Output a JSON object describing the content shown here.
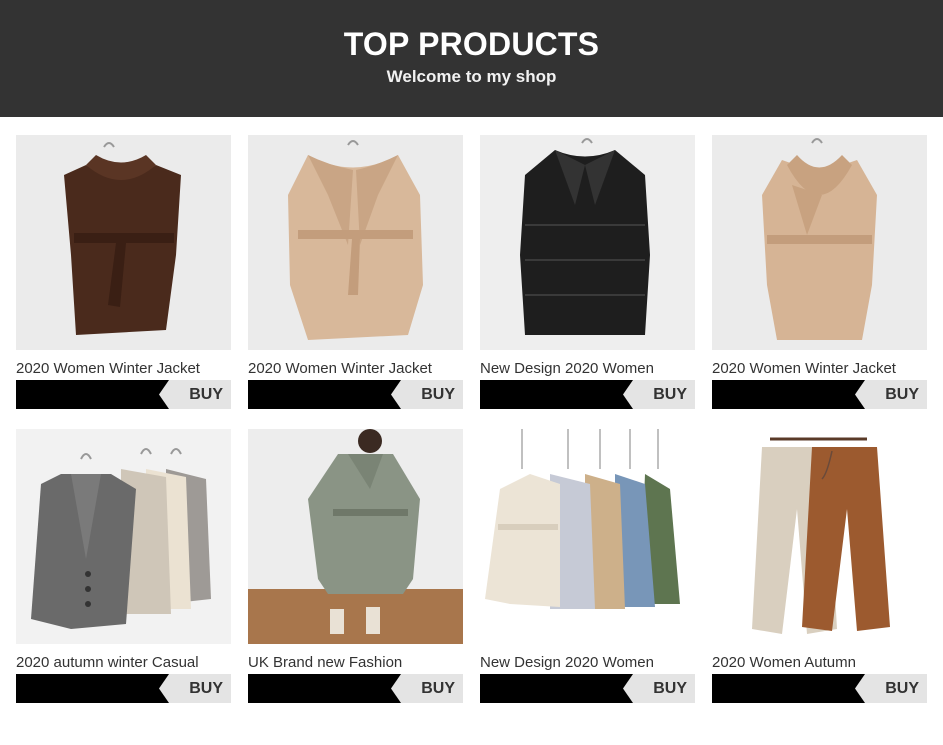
{
  "header": {
    "title": "TOP PRODUCTS",
    "subtitle": "Welcome to my shop"
  },
  "buy_label": "BUY",
  "products": [
    {
      "name": "2020 Women Winter Jacket",
      "image": "brown-hooded-coat"
    },
    {
      "name": "2020 Women Winter Jacket",
      "image": "beige-wrap-coat"
    },
    {
      "name": "New Design 2020 Women",
      "image": "black-puffer-coat"
    },
    {
      "name": "2020 Women Winter Jacket",
      "image": "camel-scarf-coat"
    },
    {
      "name": "2020 autumn winter Casual",
      "image": "knit-cardigans-on-hangers"
    },
    {
      "name": "UK Brand new Fashion",
      "image": "green-trench-coat-model"
    },
    {
      "name": "New Design 2020 Women",
      "image": "five-color-coats"
    },
    {
      "name": "2020 Women Autumn",
      "image": "wide-leg-pants"
    }
  ]
}
